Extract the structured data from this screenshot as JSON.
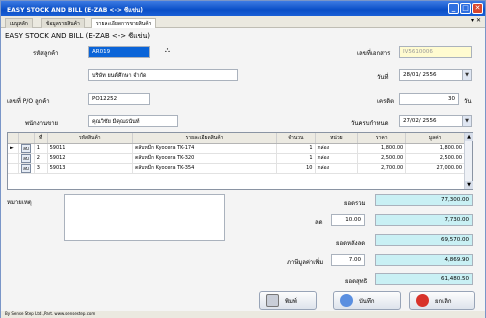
{
  "window": {
    "title": "EASY STOCK AND BILL (E-ZAB <-> ซีแข่น)"
  },
  "tabs": [
    "เมนูหลัก",
    "ข้อมูลรายสินค้า",
    "รายละเอียดการขายสินค้า"
  ],
  "app_title": "EASY STOCK AND BILL (E-ZAB <-> ซีแข่น)",
  "form": {
    "customer_code_label": "รหัสลูกค้า",
    "customer_code": "AR019",
    "doc_no_label": "เลขที่เอกสาร",
    "doc_no": "IV5610006",
    "customer_name": "บริษัท ยนต์ศึกษา จำกัด",
    "date_label": "วันที่",
    "date": "28/01/ 2556",
    "po_label": "เลขที่ P/O ลูกค้า",
    "po_no": "PO12252",
    "credit_label": "เครดิต",
    "credit": "30",
    "credit_unit": "วัน",
    "salesman_label": "พนักงานขาย",
    "salesman": "คุณวิชัย มีคุณธนันท์",
    "due_label": "วันครบกำหนด",
    "due_date": "27/02/ 2556"
  },
  "grid": {
    "headers": [
      "ที่",
      "รหัสสินค้า",
      "รายละเอียดสินค้า",
      "จำนวน",
      "หน่วย",
      "ราคา",
      "มูลค่า"
    ],
    "edit_label": "ลบ",
    "rows": [
      {
        "no": "1",
        "code": "59011",
        "desc": "ตลับหมึก Kyocera TK-174",
        "qty": "1",
        "unit": "กล่อง",
        "price": "1,800.00",
        "amount": "1,800.00"
      },
      {
        "no": "2",
        "code": "59012",
        "desc": "ตลับหมึก Kyocera TK-320",
        "qty": "1",
        "unit": "กล่อง",
        "price": "2,500.00",
        "amount": "2,500.00"
      },
      {
        "no": "3",
        "code": "59013",
        "desc": "ตลับหมึก Kyocera TK-354",
        "qty": "10",
        "unit": "กล่อง",
        "price": "2,700.00",
        "amount": "27,000.00"
      }
    ]
  },
  "summary": {
    "remark_label": "หมายเหตุ",
    "total_label": "ยอดรวม",
    "total": "77,300.00",
    "discount_label": "ลด",
    "discount_pct": "10.00",
    "discount": "7,730.00",
    "after_label": "ยอดหลังลด",
    "after": "69,570.00",
    "vat_label": "ภาษีมูลค่าเพิ่ม",
    "vat_pct": "7.00",
    "vat": "4,869.90",
    "net_label": "ยอดสุทธิ",
    "net": "61,480.50"
  },
  "buttons": {
    "print": "พิมพ์",
    "save": "บันทึก",
    "cancel": "ยกเลิก"
  },
  "status_text": "By Sense Step Ltd.,Part. www.sensestep.com",
  "colors": {
    "title_bar": "#0a4fc7",
    "field_blue": "#c9f0f4",
    "field_yellow": "#fffbd0"
  }
}
